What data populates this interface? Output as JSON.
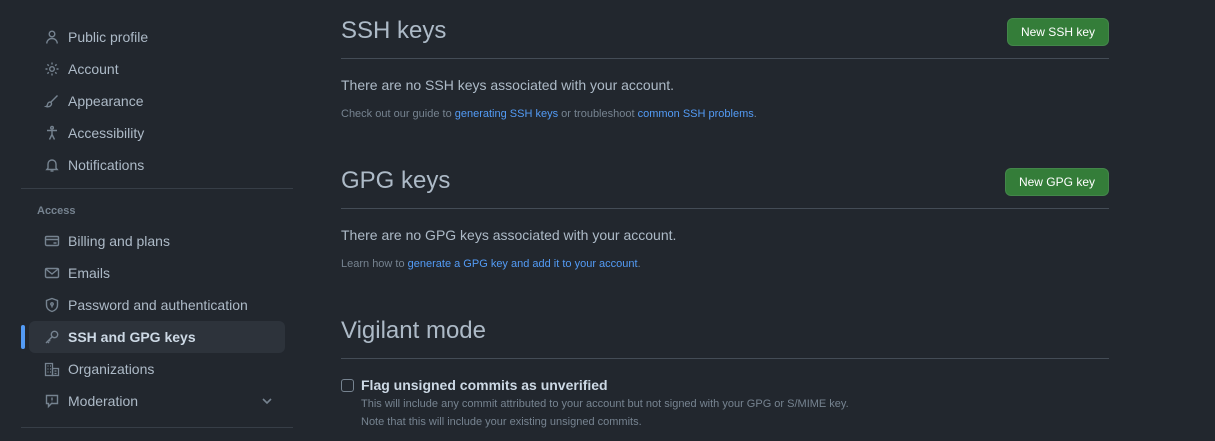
{
  "sidebar": {
    "items_top": [
      {
        "label": "Public profile",
        "icon": "person-icon"
      },
      {
        "label": "Account",
        "icon": "gear-icon"
      },
      {
        "label": "Appearance",
        "icon": "paintbrush-icon"
      },
      {
        "label": "Accessibility",
        "icon": "accessibility-icon"
      },
      {
        "label": "Notifications",
        "icon": "bell-icon"
      }
    ],
    "access_heading": "Access",
    "items_access": [
      {
        "label": "Billing and plans",
        "icon": "credit-card-icon"
      },
      {
        "label": "Emails",
        "icon": "mail-icon"
      },
      {
        "label": "Password and authentication",
        "icon": "shield-lock-icon"
      },
      {
        "label": "SSH and GPG keys",
        "icon": "key-icon",
        "active": true
      },
      {
        "label": "Organizations",
        "icon": "organization-icon"
      },
      {
        "label": "Moderation",
        "icon": "report-icon"
      }
    ]
  },
  "ssh": {
    "title": "SSH keys",
    "button": "New SSH key",
    "empty": "There are no SSH keys associated with your account.",
    "help_prefix": "Check out our guide to ",
    "help_link1": "generating SSH keys",
    "help_middle": " or troubleshoot ",
    "help_link2": "common SSH problems",
    "help_suffix": "."
  },
  "gpg": {
    "title": "GPG keys",
    "button": "New GPG key",
    "empty": "There are no GPG keys associated with your account.",
    "help_prefix": "Learn how to ",
    "help_link": "generate a GPG key and add it to your account",
    "help_suffix": "."
  },
  "vigilant": {
    "title": "Vigilant mode",
    "checkbox_label": "Flag unsigned commits as unverified",
    "checked": false,
    "note1": "This will include any commit attributed to your account but not signed with your GPG or S/MIME key.",
    "note2": "Note that this will include your existing unsigned commits."
  },
  "colors": {
    "background": "#22272e",
    "accent": "#539bf5",
    "primary_button": "#347d39"
  }
}
